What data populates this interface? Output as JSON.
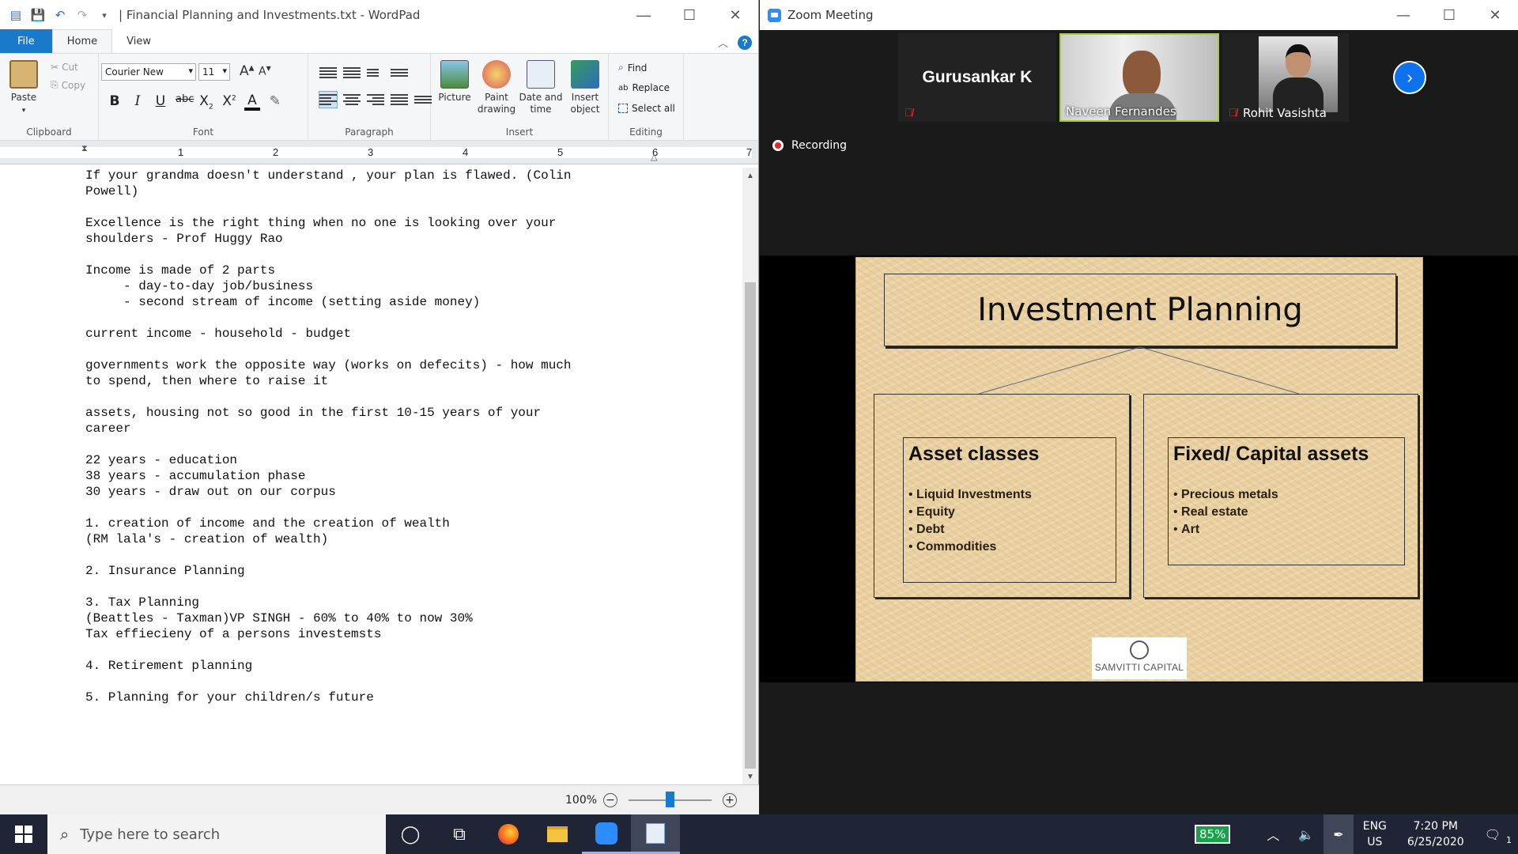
{
  "wordpad": {
    "title": "| Financial Planning and Investments.txt - WordPad",
    "tabs": [
      "File",
      "Home",
      "View"
    ],
    "clipboard": {
      "paste": "Paste",
      "cut": "Cut",
      "copy": "Copy",
      "label": "Clipboard"
    },
    "font": {
      "family": "Courier New",
      "size": "11",
      "label": "Font"
    },
    "paragraph": {
      "label": "Paragraph"
    },
    "insert": {
      "picture": "Picture",
      "paint": "Paint drawing",
      "datetime": "Date and time",
      "object": "Insert object",
      "label": "Insert"
    },
    "editing": {
      "find": "Find",
      "replace": "Replace",
      "select_all": "Select all",
      "label": "Editing"
    },
    "ruler": [
      "1",
      "2",
      "3",
      "4",
      "5",
      "6",
      "7"
    ],
    "document_lines": [
      "If your grandma doesn't understand , your plan is flawed. (Colin",
      "Powell)",
      "",
      "Excellence is the right thing when no one is looking over your",
      "shoulders - Prof Huggy Rao",
      "",
      "Income is made of 2 parts",
      "     - day-to-day job/business",
      "     - second stream of income (setting aside money)",
      "",
      "current income - household - budget",
      "",
      "governments work the opposite way (works on defecits) - how much",
      "to spend, then where to raise it",
      "",
      "assets, housing not so good in the first 10-15 years of your",
      "career",
      "",
      "22 years - education",
      "38 years - accumulation phase",
      "30 years - draw out on our corpus",
      "",
      "1. creation of income and the creation of wealth",
      "(RM lala's - creation of wealth)",
      "",
      "2. Insurance Planning",
      "",
      "3. Tax Planning",
      "(Beattles - Taxman)VP SINGH - 60% to 40% to now 30%",
      "Tax effiecieny of a persons investemsts",
      "",
      "4. Retirement planning",
      "",
      "5. Planning for your children/s future"
    ],
    "zoom_level": "100%",
    "zoom_slider_fraction": 0.5
  },
  "zoom": {
    "title": "Zoom Meeting",
    "participants": [
      {
        "name": "Gurusankar K",
        "muted": true,
        "video": false
      },
      {
        "name": "Naveen Fernandes",
        "muted": false,
        "video": true,
        "active_speaker": true
      },
      {
        "name": "Rohit Vasishta",
        "muted": true,
        "video": true
      }
    ],
    "recording_label": "Recording",
    "slide": {
      "title": "Investment Planning",
      "left_box": {
        "title": "Asset classes",
        "items": [
          "Liquid Investments",
          "Equity",
          "Debt",
          "Commodities"
        ]
      },
      "right_box": {
        "title": "Fixed/ Capital assets",
        "items": [
          "Precious metals",
          "Real estate",
          "Art"
        ]
      },
      "logo_text": "SAMVITTI CAPITAL"
    }
  },
  "taskbar": {
    "search_placeholder": "Type here to search",
    "battery": "85%",
    "lang_1": "ENG",
    "lang_2": "US",
    "time": "7:20 PM",
    "date": "6/25/2020",
    "notification_count": "1"
  },
  "colors": {
    "accent": "#1979ca",
    "zoom_blue": "#0e72ed",
    "taskbar": "#1f2535",
    "slide_bg": "#e9d0a0"
  }
}
